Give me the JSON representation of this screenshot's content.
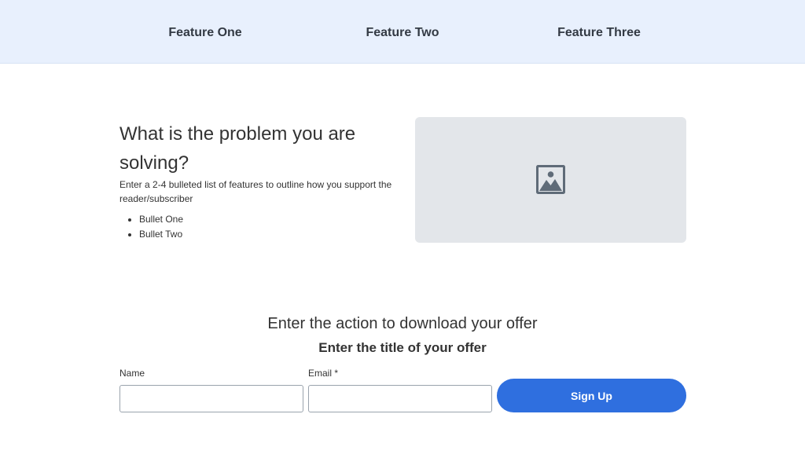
{
  "nav": {
    "items": [
      {
        "label": "Feature One"
      },
      {
        "label": "Feature Two"
      },
      {
        "label": "Feature Three"
      }
    ]
  },
  "problem": {
    "heading": "What is the problem you are solving?",
    "description": "Enter a 2-4 bulleted list of features to outline how you support the reader/subscriber",
    "bullets": [
      "Bullet One",
      "Bullet Two"
    ]
  },
  "image": {
    "icon": "image-placeholder-icon"
  },
  "offer": {
    "action": "Enter the action to download your offer",
    "title": "Enter the title of your offer"
  },
  "form": {
    "name_label": "Name",
    "name_value": "",
    "email_label": "Email *",
    "email_value": "",
    "submit_label": "Sign Up"
  },
  "colors": {
    "nav_background": "#e8f0fd",
    "button": "#2f6fdf",
    "image_placeholder": "#e3e6ea"
  }
}
